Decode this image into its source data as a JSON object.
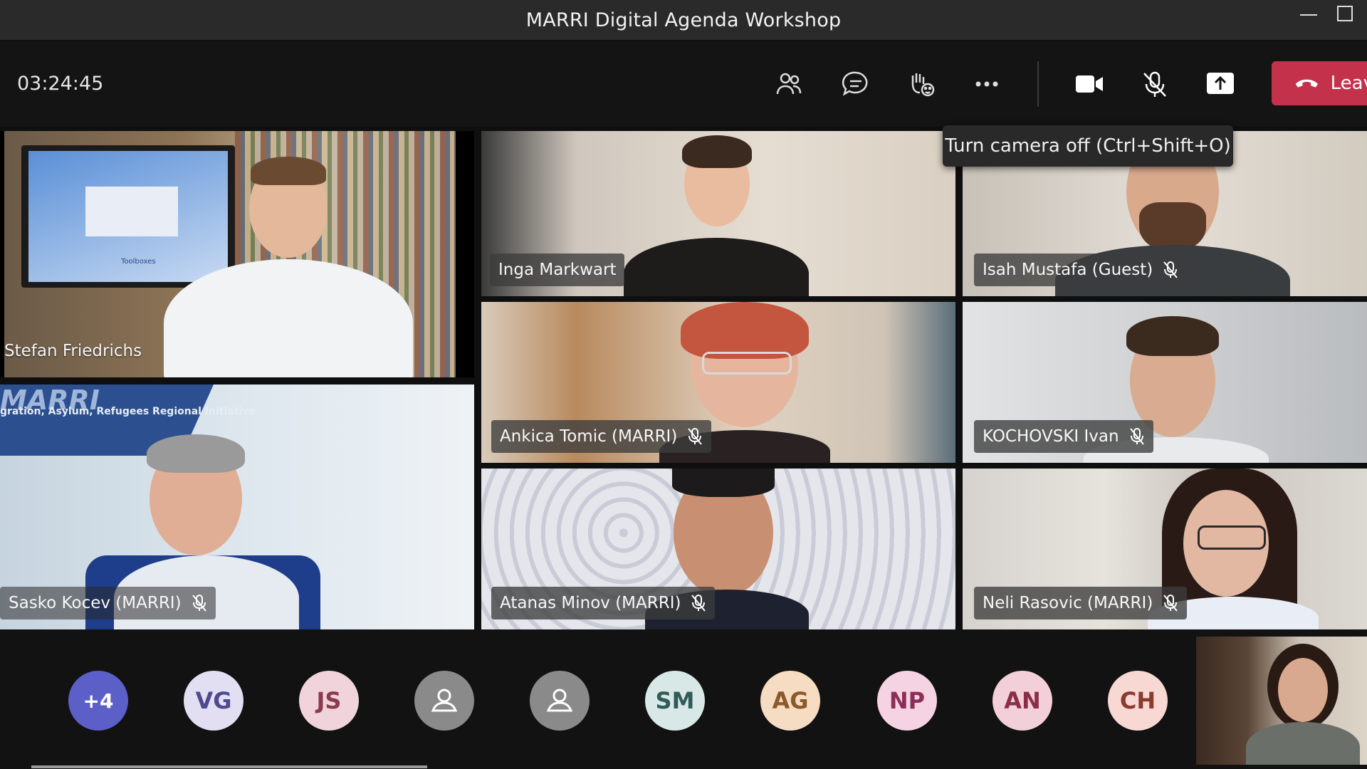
{
  "window": {
    "title": "MARRI Digital Agenda Workshop"
  },
  "controls": {
    "timer": "03:24:45",
    "leave_label": "Leave",
    "icons": [
      "people-icon",
      "chat-icon",
      "raise-hand-icon",
      "more-icon",
      "camera-icon",
      "mic-off-icon",
      "share-icon",
      "phone-hangup-icon"
    ]
  },
  "tooltip": {
    "text": "Turn camera off (Ctrl+Shift+O)"
  },
  "participants": [
    {
      "name": "Stefan Friedrichs",
      "muted": false
    },
    {
      "name": "Inga Markwart",
      "muted": false
    },
    {
      "name": "Isah Mustafa (Guest)",
      "muted": true
    },
    {
      "name": "Ankica Tomic (MARRI)",
      "muted": true
    },
    {
      "name": "KOCHOVSKI Ivan",
      "muted": true
    },
    {
      "name": "Sasko Kocev (MARRI)",
      "muted": true
    },
    {
      "name": "Atanas Minov (MARRI)",
      "muted": true
    },
    {
      "name": "Neli Rasovic (MARRI)",
      "muted": true
    }
  ],
  "stefan_screen": {
    "toolbox_text": "Toolboxes",
    "banner_text": "MARRI",
    "banner_subtext": "gration, Asylum, Refugees Regional Initiative"
  },
  "roster": {
    "overflow": "+4",
    "avatars": [
      {
        "initials": "VG",
        "bg": "#e3dff3",
        "fg": "#4f4a8e"
      },
      {
        "initials": "JS",
        "bg": "#f1d4db",
        "fg": "#8a3b4d"
      },
      {
        "initials": "",
        "bg": "#8a8a8a",
        "fg": "#ffffff"
      },
      {
        "initials": "",
        "bg": "#8a8a8a",
        "fg": "#ffffff"
      },
      {
        "initials": "SM",
        "bg": "#d8e8e6",
        "fg": "#2f5c58"
      },
      {
        "initials": "AG",
        "bg": "#f6dcc2",
        "fg": "#8a5a2a"
      },
      {
        "initials": "NP",
        "bg": "#f6d3e3",
        "fg": "#8b2e58"
      },
      {
        "initials": "AN",
        "bg": "#f3cfd9",
        "fg": "#8a2e47"
      },
      {
        "initials": "CH",
        "bg": "#f7d8d2",
        "fg": "#8b3a2e"
      }
    ]
  },
  "colors": {
    "leave": "#c4314b",
    "overflow_avatar": "#5b5fc7"
  }
}
